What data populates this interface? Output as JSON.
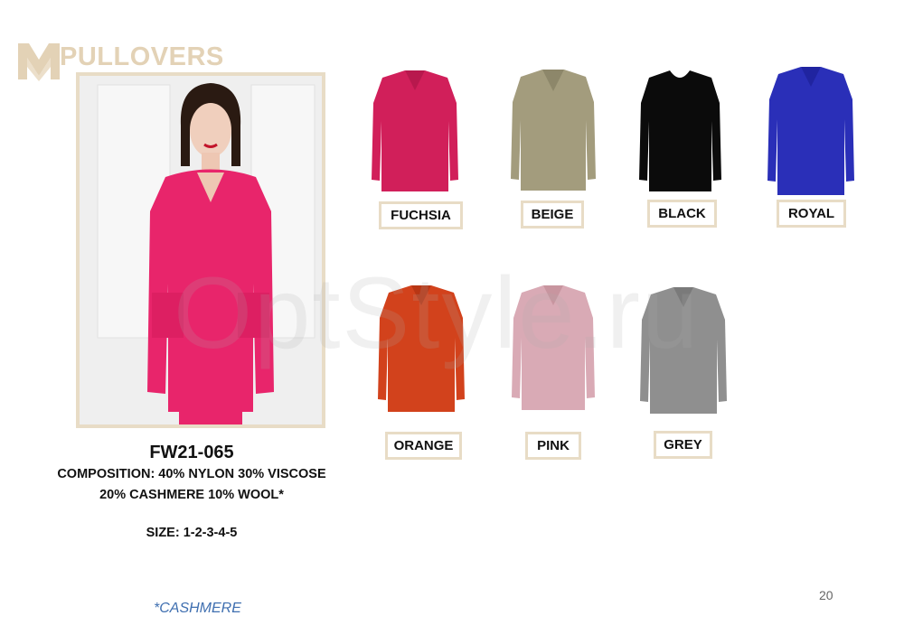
{
  "header": {
    "title": "PULLOVERS"
  },
  "product": {
    "code": "FW21-065",
    "composition_line1": "COMPOSITION: 40% NYLON 30% VISCOSE",
    "composition_line2": "20% CASHMERE 10% WOOL*",
    "size": "SIZE: 1-2-3-4-5",
    "footnote": "*CASHMERE"
  },
  "colors": [
    {
      "label": "FUCHSIA",
      "hex": "#d11f5a"
    },
    {
      "label": "BEIGE",
      "hex": "#a39c7d"
    },
    {
      "label": "BLACK",
      "hex": "#0b0b0b"
    },
    {
      "label": "ROYAL",
      "hex": "#2a2fb8"
    },
    {
      "label": "ORANGE",
      "hex": "#d2421c"
    },
    {
      "label": "PINK",
      "hex": "#d9aab5"
    },
    {
      "label": "GREY",
      "hex": "#8f8f8f"
    }
  ],
  "watermark": "OptStyle.ru",
  "page_number": "20"
}
